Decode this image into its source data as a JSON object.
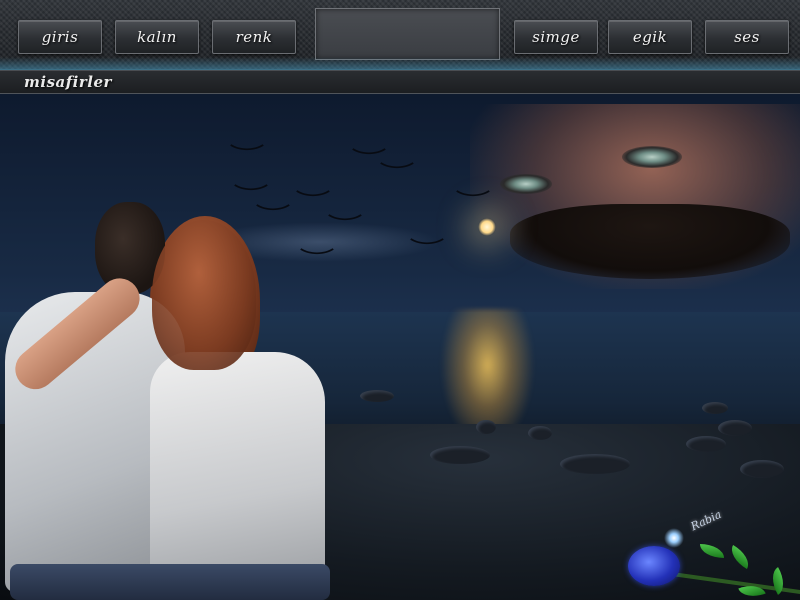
{
  "nav": {
    "left": [
      {
        "id": "giris",
        "label": "giris"
      },
      {
        "id": "kalin",
        "label": "kalın"
      },
      {
        "id": "renk",
        "label": "renk"
      }
    ],
    "right": [
      {
        "id": "simge",
        "label": "simge"
      },
      {
        "id": "egik",
        "label": "egik"
      },
      {
        "id": "ses",
        "label": "ses"
      }
    ]
  },
  "header": {
    "title": "misafirler"
  },
  "scene": {
    "signature": "Rabia"
  },
  "colors": {
    "accent": "#4994b6",
    "button_bg": "#2c2f33",
    "scene_sky": "#182a44"
  }
}
